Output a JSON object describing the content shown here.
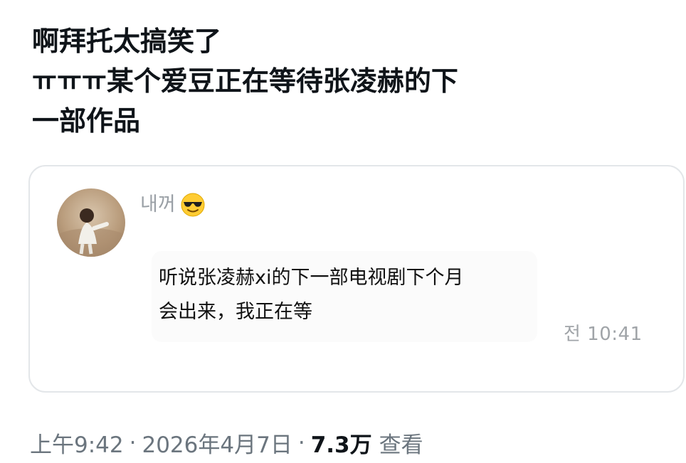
{
  "post": {
    "lines": [
      "啊拜托太搞笑了",
      "ㅠㅠㅠ某个爱豆正在等待张凌赫的下",
      "一部作品"
    ]
  },
  "quoted_message": {
    "sender_name": "내꺼",
    "sender_emoji": "😎",
    "text_lines": [
      "听说张凌赫xi的下一部电视剧下个月",
      "会出来，我正在等"
    ],
    "time": "전 10:41"
  },
  "meta": {
    "time": "上午9:42",
    "date": "2026年4月7日",
    "separator": "·",
    "views": "7.3万",
    "views_label": "查看"
  },
  "colors": {
    "text": "#0f1419",
    "muted": "#6b757e",
    "card_border": "#e3e6e9"
  },
  "icons": {
    "avatar": "profile-photo",
    "emoji": "sunglasses-emoji-icon"
  }
}
